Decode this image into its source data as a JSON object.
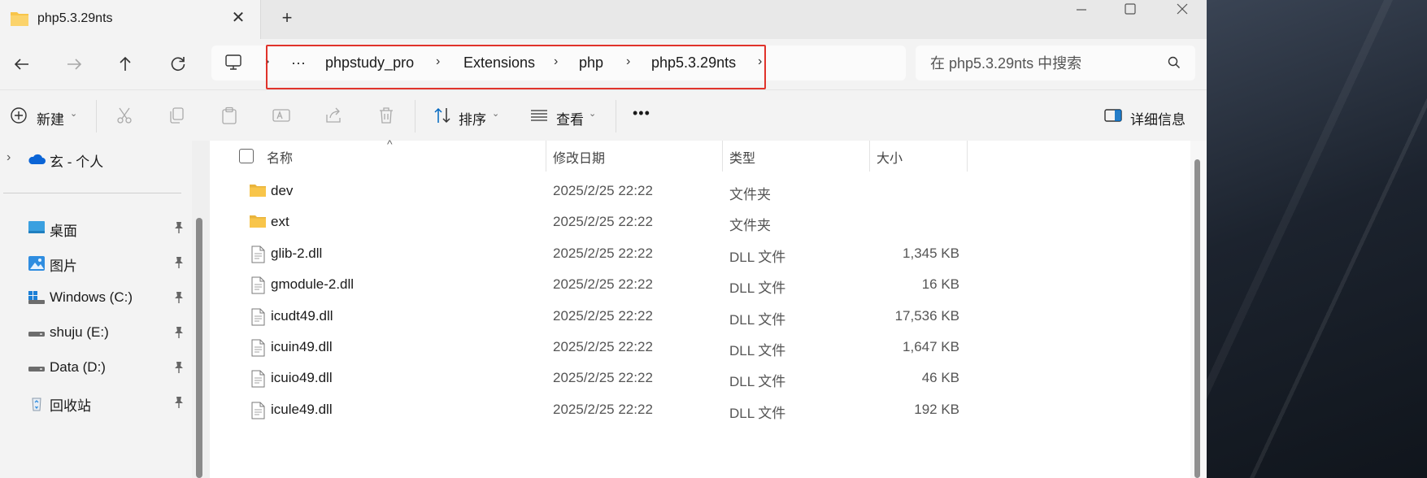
{
  "tab": {
    "title": "php5.3.29nts",
    "close": "✕",
    "new": "+"
  },
  "window_controls": {
    "minimize": "—",
    "maximize": "☐",
    "close": "✕"
  },
  "nav": {
    "back": "←",
    "forward": "→",
    "up": "↑",
    "refresh": "↻"
  },
  "address": {
    "more": "···",
    "sep": "›",
    "crumbs": [
      "phpstudy_pro",
      "Extensions",
      "php",
      "php5.3.29nts"
    ]
  },
  "search": {
    "placeholder": "在 php5.3.29nts 中搜索"
  },
  "commands": {
    "new_label": "新建",
    "sort_label": "排序",
    "view_label": "查看",
    "more": "•••",
    "details_label": "详细信息",
    "caret": "⌄"
  },
  "sidebar": {
    "expander": "›",
    "cloud_label": "玄 - 个人",
    "items": [
      {
        "label": "桌面",
        "icon": "desktop-icon"
      },
      {
        "label": "图片",
        "icon": "pictures-icon"
      },
      {
        "label": "Windows (C:)",
        "icon": "windows-drive-icon"
      },
      {
        "label": "shuju (E:)",
        "icon": "drive-icon"
      },
      {
        "label": "Data (D:)",
        "icon": "drive-icon"
      },
      {
        "label": "回收站",
        "icon": "recycle-bin-icon"
      }
    ]
  },
  "columns": {
    "name": "名称",
    "date": "修改日期",
    "type": "类型",
    "size": "大小",
    "sort_arrow": "^"
  },
  "files": [
    {
      "name": "dev",
      "date": "2025/2/25 22:22",
      "type": "文件夹",
      "size": "",
      "kind": "folder"
    },
    {
      "name": "ext",
      "date": "2025/2/25 22:22",
      "type": "文件夹",
      "size": "",
      "kind": "folder"
    },
    {
      "name": "glib-2.dll",
      "date": "2025/2/25 22:22",
      "type": "DLL 文件",
      "size": "1,345 KB",
      "kind": "file"
    },
    {
      "name": "gmodule-2.dll",
      "date": "2025/2/25 22:22",
      "type": "DLL 文件",
      "size": "16 KB",
      "kind": "file"
    },
    {
      "name": "icudt49.dll",
      "date": "2025/2/25 22:22",
      "type": "DLL 文件",
      "size": "17,536 KB",
      "kind": "file"
    },
    {
      "name": "icuin49.dll",
      "date": "2025/2/25 22:22",
      "type": "DLL 文件",
      "size": "1,647 KB",
      "kind": "file"
    },
    {
      "name": "icuio49.dll",
      "date": "2025/2/25 22:22",
      "type": "DLL 文件",
      "size": "46 KB",
      "kind": "file"
    },
    {
      "name": "icule49.dll",
      "date": "2025/2/25 22:22",
      "type": "DLL 文件",
      "size": "192 KB",
      "kind": "file"
    }
  ],
  "colors": {
    "folder": "#f8c54a",
    "accent": "#0067c0",
    "highlight": "#e0332b"
  }
}
